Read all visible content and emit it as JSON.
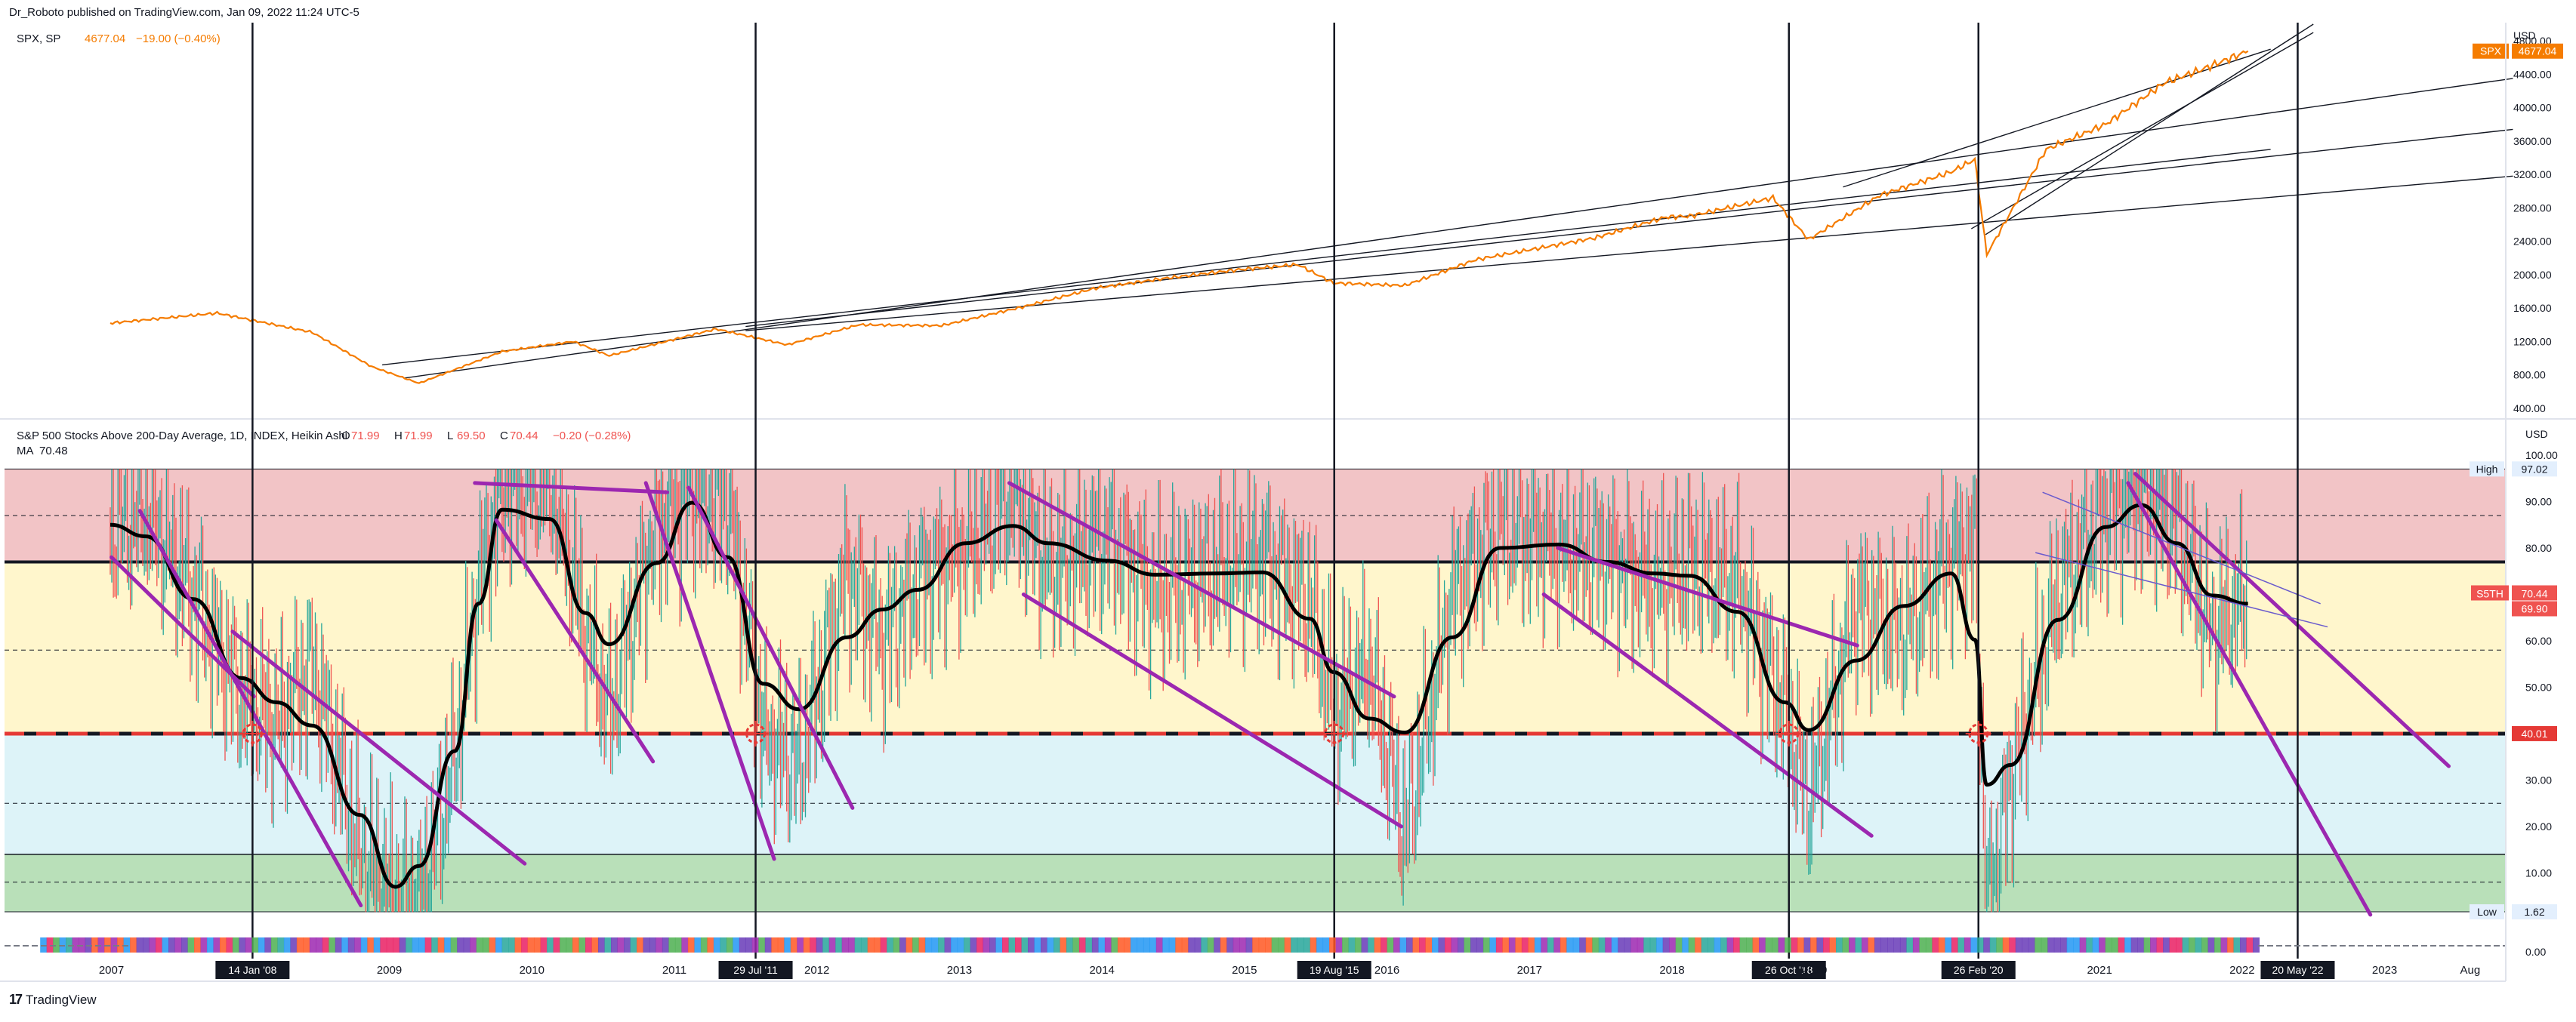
{
  "header": {
    "published": "Dr_Roboto published on TradingView.com, Jan 09, 2022 11:24 UTC-5"
  },
  "top_pane": {
    "symbol": "SPX, SP",
    "last": "4677.04",
    "change": "−19.00 (−0.40%)",
    "currency": "USD",
    "price_tag_symbol": "SPX",
    "price_tag_value": "4677.04",
    "ticks": [
      "4800.00",
      "4400.00",
      "4000.00",
      "3600.00",
      "3200.00",
      "2800.00",
      "2400.00",
      "2000.00",
      "1600.00",
      "1200.00",
      "800.00",
      "400.00"
    ]
  },
  "bottom_pane": {
    "title": "S&P 500 Stocks Above 200-Day Average, 1D, INDEX, Heikin Ashi",
    "o_label": "O",
    "o_value": "71.99",
    "h_label": "H",
    "h_value": "71.99",
    "l_label": "L",
    "l_value": "69.50",
    "c_label": "C",
    "c_value": "70.44",
    "change": "−0.20 (−0.28%)",
    "ma_label": "MA",
    "ma_value": "70.48",
    "currency": "USD",
    "ticks": [
      "100.00",
      "90.00",
      "80.00",
      "70.00",
      "60.00",
      "50.00",
      "40.00",
      "30.00",
      "20.00",
      "10.00",
      "0.00"
    ],
    "high_label": "High",
    "high_value": "97.02",
    "low_label": "Low",
    "low_value": "1.62",
    "last_symbol": "S5TH",
    "last_value": "70.44",
    "ma_tag": "69.90",
    "level_tag": "40.01"
  },
  "x_axis": {
    "years": [
      "2007",
      "2009",
      "2010",
      "2011",
      "2012",
      "2013",
      "2014",
      "2015",
      "2016",
      "2017",
      "2018",
      "2020",
      "2021",
      "2022",
      "2023",
      "Aug"
    ]
  },
  "event_labels": [
    "14 Jan '08",
    "29 Jul '11",
    "19 Aug '15",
    "26 Oct '18",
    "26 Feb '20",
    "20 May '22"
  ],
  "footer": {
    "brand": "TradingView"
  },
  "colors": {
    "price": "#f57c00",
    "breadth_up": "#26a69a",
    "breadth_down": "#ef5350",
    "ma": "#000000",
    "trend_purple": "#9c27b0",
    "zone_high": "#f2c4c6",
    "zone_mid": "#fff6cc",
    "zone_low": "#ddf3f8",
    "zone_bottom": "#b9e0b9",
    "level_red": "#e53935"
  },
  "chart_data": [
    {
      "type": "line",
      "series": [
        {
          "name": "SPX",
          "x": [
            "2007-01",
            "2007-10",
            "2008-06",
            "2008-11",
            "2009-03",
            "2009-10",
            "2010-04",
            "2010-07",
            "2011-04",
            "2011-10",
            "2012-04",
            "2012-11",
            "2013-06",
            "2013-12",
            "2014-06",
            "2014-12",
            "2015-05",
            "2015-08",
            "2016-02",
            "2016-08",
            "2017-06",
            "2017-12",
            "2018-02",
            "2018-09",
            "2018-12",
            "2019-06",
            "2019-12",
            "2020-02",
            "2020-03",
            "2020-08",
            "2021-01",
            "2021-06",
            "2021-09",
            "2022-01"
          ],
          "values": [
            1420,
            1540,
            1310,
            900,
            700,
            1080,
            1200,
            1030,
            1350,
            1160,
            1400,
            1390,
            1620,
            1840,
            1960,
            2060,
            2120,
            1900,
            1870,
            2180,
            2440,
            2690,
            2700,
            2920,
            2420,
            2950,
            3230,
            3380,
            2240,
            3500,
            3800,
            4300,
            4450,
            4677
          ]
        }
      ],
      "ylim": [
        300,
        5000
      ],
      "yscale": "linear"
    },
    {
      "type": "line",
      "series": [
        {
          "name": "S5TH",
          "x": [
            "2007-01",
            "2007-04",
            "2007-08",
            "2007-12",
            "2008-03",
            "2008-06",
            "2008-10",
            "2009-01",
            "2009-03",
            "2009-06",
            "2009-08",
            "2009-10",
            "2010-02",
            "2010-05",
            "2010-07",
            "2010-11",
            "2011-02",
            "2011-05",
            "2011-08",
            "2011-11",
            "2012-03",
            "2012-06",
            "2012-09",
            "2013-01",
            "2013-05",
            "2013-08",
            "2014-01",
            "2014-05",
            "2014-10",
            "2015-02",
            "2015-06",
            "2015-08",
            "2015-11",
            "2016-02",
            "2016-06",
            "2016-10",
            "2017-03",
            "2017-07",
            "2017-11",
            "2018-02",
            "2018-06",
            "2018-10",
            "2018-12",
            "2019-04",
            "2019-08",
            "2019-12",
            "2020-02",
            "2020-03",
            "2020-05",
            "2020-09",
            "2021-01",
            "2021-04",
            "2021-07",
            "2021-10",
            "2022-01"
          ],
          "values": [
            84,
            88,
            70,
            48,
            42,
            55,
            15,
            5,
            3,
            35,
            72,
            93,
            95,
            62,
            45,
            85,
            92,
            90,
            40,
            33,
            75,
            60,
            72,
            80,
            92,
            75,
            82,
            70,
            75,
            78,
            68,
            45,
            55,
            18,
            70,
            85,
            80,
            78,
            72,
            76,
            72,
            45,
            25,
            68,
            62,
            78,
            80,
            3,
            30,
            70,
            88,
            92,
            85,
            62,
            70
          ]
        }
      ],
      "ylim": [
        0,
        100
      ],
      "levels": {
        "high": 97.02,
        "low": 1.62,
        "upper_band": 77,
        "lower_band": 40.01,
        "bottom_band": 14
      }
    }
  ]
}
